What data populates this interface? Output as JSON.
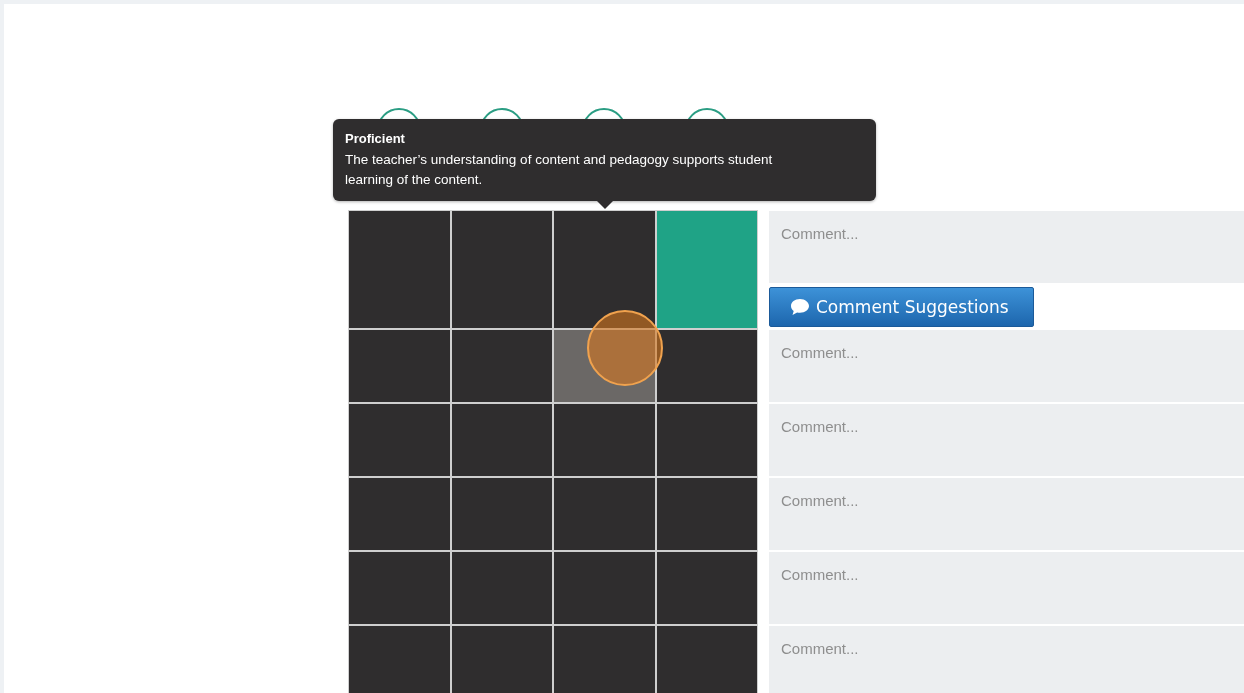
{
  "tooltip": {
    "title": "Proficient",
    "text": "The teacher’s understanding of content and pedagogy supports student learning of the content."
  },
  "rows": [
    {
      "cells": [
        {
          "selected": false,
          "hovered": false,
          "clicked": false
        },
        {
          "selected": false,
          "hovered": false,
          "clicked": false
        },
        {
          "selected": false,
          "hovered": false,
          "clicked": false
        },
        {
          "selected": true,
          "hovered": false,
          "clicked": false
        }
      ],
      "comment": {
        "placeholder": "Comment..."
      },
      "suggestions_button": "Comment Suggestions"
    },
    {
      "cells": [
        {
          "selected": false,
          "hovered": false,
          "clicked": false
        },
        {
          "selected": false,
          "hovered": false,
          "clicked": false
        },
        {
          "selected": false,
          "hovered": true,
          "clicked": true
        },
        {
          "selected": false,
          "hovered": false,
          "clicked": false
        }
      ],
      "comment": {
        "placeholder": "Comment..."
      }
    },
    {
      "cells": [
        {
          "selected": false,
          "hovered": false,
          "clicked": false
        },
        {
          "selected": false,
          "hovered": false,
          "clicked": false
        },
        {
          "selected": false,
          "hovered": false,
          "clicked": false
        },
        {
          "selected": false,
          "hovered": false,
          "clicked": false
        }
      ],
      "comment": {
        "placeholder": "Comment..."
      }
    },
    {
      "cells": [
        {
          "selected": false,
          "hovered": false,
          "clicked": false
        },
        {
          "selected": false,
          "hovered": false,
          "clicked": false
        },
        {
          "selected": false,
          "hovered": false,
          "clicked": false
        },
        {
          "selected": false,
          "hovered": false,
          "clicked": false
        }
      ],
      "comment": {
        "placeholder": "Comment..."
      }
    },
    {
      "cells": [
        {
          "selected": false,
          "hovered": false,
          "clicked": false
        },
        {
          "selected": false,
          "hovered": false,
          "clicked": false
        },
        {
          "selected": false,
          "hovered": false,
          "clicked": false
        },
        {
          "selected": false,
          "hovered": false,
          "clicked": false
        }
      ],
      "comment": {
        "placeholder": "Comment..."
      }
    },
    {
      "cells": [
        {
          "selected": false,
          "hovered": false,
          "clicked": false
        },
        {
          "selected": false,
          "hovered": false,
          "clicked": false
        },
        {
          "selected": false,
          "hovered": false,
          "clicked": false
        },
        {
          "selected": false,
          "hovered": false,
          "clicked": false
        }
      ],
      "comment": {
        "placeholder": "Comment..."
      }
    }
  ]
}
